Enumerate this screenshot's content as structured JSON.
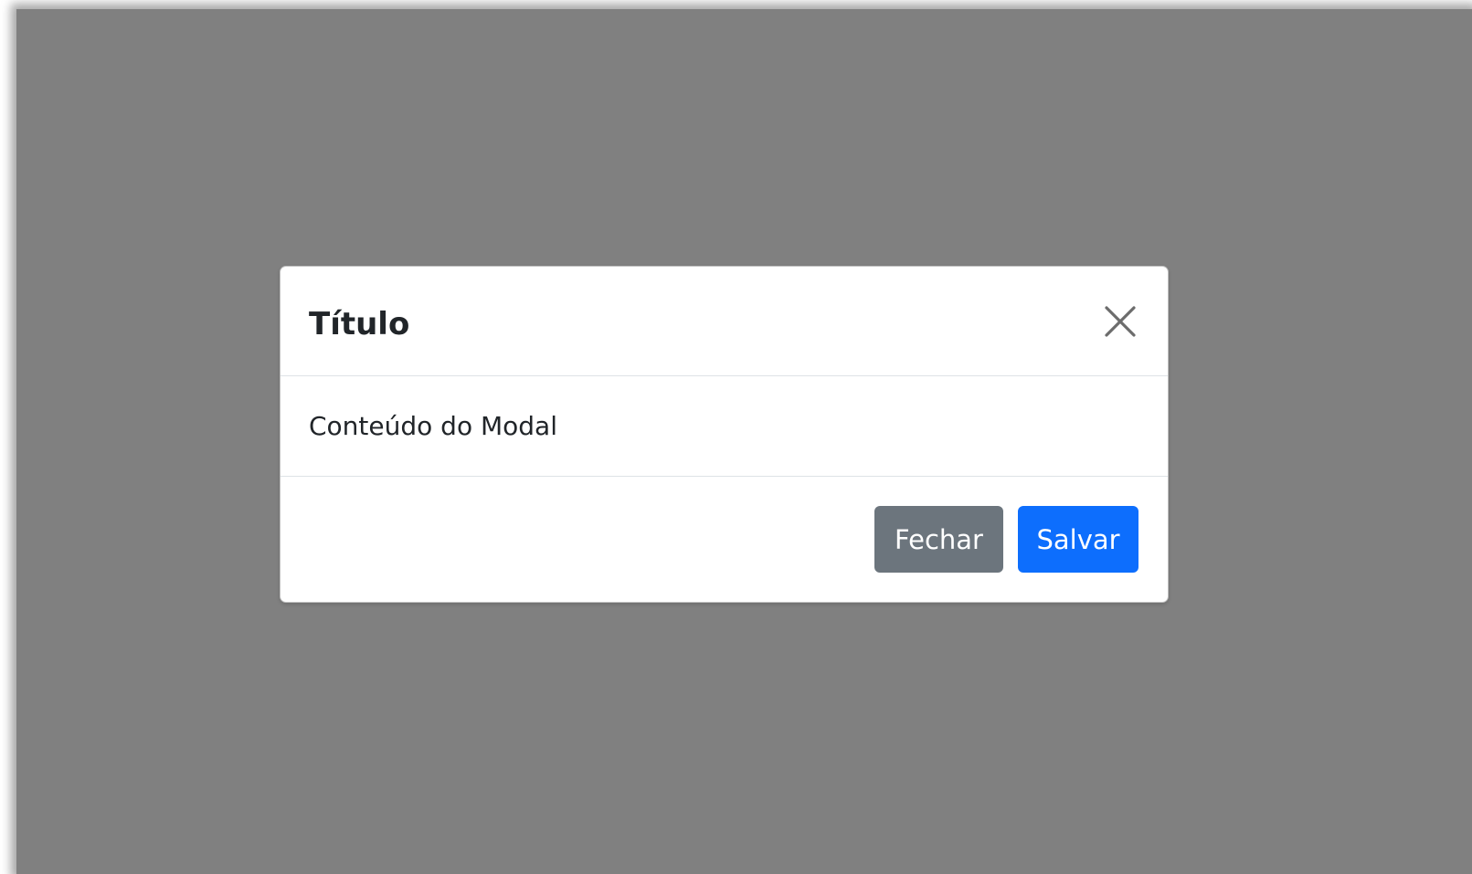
{
  "modal": {
    "title": "Título",
    "body_text": "Conteúdo do Modal",
    "close_icon": "close-icon",
    "buttons": {
      "close_label": "Fechar",
      "save_label": "Salvar"
    }
  },
  "colors": {
    "backdrop": "#808080",
    "primary": "#0d6efd",
    "secondary": "#6c757d",
    "text": "#212529"
  }
}
